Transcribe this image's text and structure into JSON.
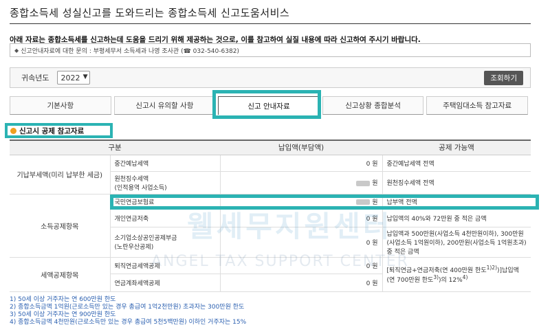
{
  "header": {
    "title": "종합소득세 성실신고를 도와드리는 종합소득세 신고도움서비스"
  },
  "notice": {
    "text": "아래 자료는 종합소득세를 신고하는데 도움을 드리기 위해 제공하는 것으로, 이를 참고하여 실질 내용에 따라 신고하여 주시기 바랍니다.",
    "contact": "신고안내자료에 대한 문의 : 부평세무서 소득세과 나영 조사관 (☎ 032-540-6382)"
  },
  "year_filter": {
    "label": "귀속년도",
    "selected": "2022",
    "search_label": "조회하기"
  },
  "tabs": [
    {
      "label": "기본사항",
      "active": false
    },
    {
      "label": "신고시 유의할 사항",
      "active": false
    },
    {
      "label": "신고 안내자료",
      "active": true
    },
    {
      "label": "신고상황 종합분석",
      "active": false
    },
    {
      "label": "주택임대소득 참고자료",
      "active": false
    }
  ],
  "section": {
    "title": "신고시 공제 참고자료"
  },
  "table": {
    "headers": [
      "구분",
      "납입액(부담액)",
      "공제 가능액"
    ],
    "groups": [
      {
        "name": "기납부세액(미리 납부한 세금)",
        "rows": [
          {
            "item": "중간예납세액",
            "amount": "0 원",
            "blurred": false,
            "note": "중간예납세액 전액"
          },
          {
            "item": "원천징수세액\n(인적용역 사업소득)",
            "amount": "원",
            "blurred": true,
            "note": "원천징수세액 전액"
          }
        ]
      },
      {
        "name": "소득공제항목",
        "rows": [
          {
            "item": "국민연금보험료",
            "amount": "원",
            "blurred": true,
            "note": "납부액 전액"
          },
          {
            "item": "개인연금저축",
            "amount": "0 원",
            "blurred": false,
            "note": "납입액의 40%와 72만원 중 적은 금액"
          },
          {
            "item": "소기업소상공인공제부금\n(노란우산공제)",
            "amount": "0 원",
            "blurred": false,
            "note": "납입액과 500만원(사업소득 4천만원이하), 300만원(사업소득 1억원이하), 200만원(사업소득 1억원초과) 중 적은 금액"
          }
        ]
      },
      {
        "name": "세액공제항목",
        "rows": [
          {
            "item": "퇴직연금세액공제",
            "amount": "0 원",
            "blurred": false
          },
          {
            "item": "연금계좌세액공제",
            "amount": "0 원",
            "blurred": false
          }
        ],
        "note_part1": "[퇴직연금+연금저축(연 400만원 한도",
        "note_sup1": "1)2)",
        "note_part2": ")]납입액 (연 700만원 한도",
        "note_sup2": "3)",
        "note_part3": ")의 12%",
        "note_sup3": "4)"
      }
    ]
  },
  "watermark": {
    "main": "웰세무지원센터",
    "sub": "ANGEL TAX SUPPORT CENTER"
  },
  "footnotes": [
    "1) 50세 이상 거주자는 연 600만원 한도",
    "2) 종합소득금액 1억원(근로소득만 있는 경우 총급여 1억2천만원) 초과자는 300만원 한도",
    "3) 50세 이상 거주자는 연 900만원 한도",
    "4) 종합소득금액 4천만원(근로소득만 있는 경우 총급여 5천5백만원) 이하인 거주자는 15%"
  ],
  "colors": {
    "highlight": "#2bb3b3",
    "footnote": "#2a5fb0",
    "bullet": "#f0a020"
  }
}
